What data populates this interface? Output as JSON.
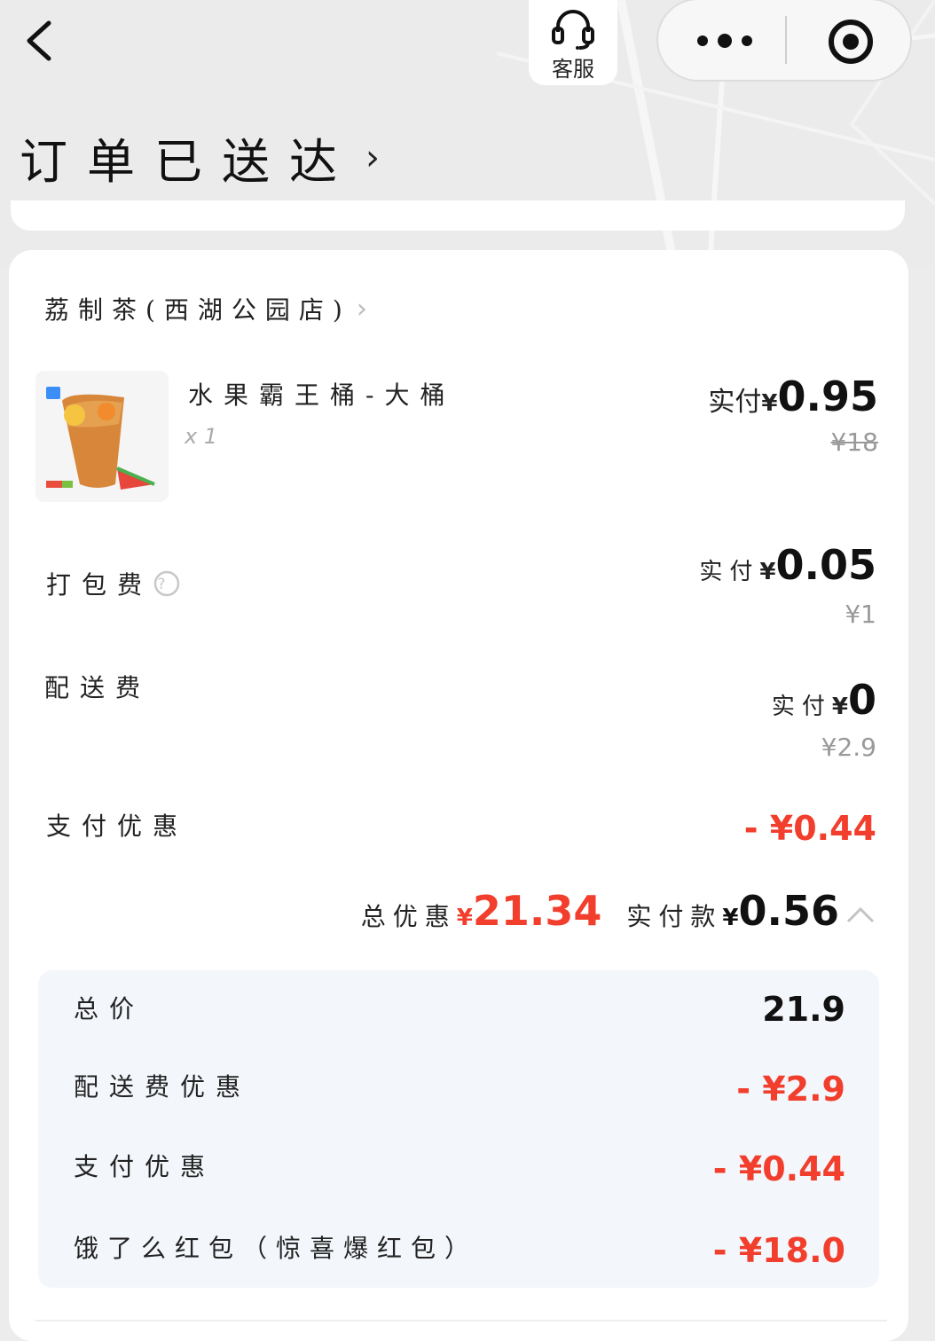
{
  "header": {
    "service_label": "客服",
    "status_title": "订单已送达"
  },
  "store": {
    "name": "荔制茶(西湖公园店)"
  },
  "product": {
    "name": "水果霸王桶-大桶",
    "qty": "x 1",
    "paid_label": "实付",
    "currency": "¥",
    "paid_amount": "0.95",
    "original_price": "¥18"
  },
  "fees": [
    {
      "label": "打包费",
      "paid_label": "实付",
      "currency": "¥",
      "paid_amount": "0.05",
      "original": "¥1"
    },
    {
      "label": "配送费",
      "paid_label": "实付",
      "currency": "¥",
      "paid_amount": "0",
      "original": "¥2.9"
    }
  ],
  "payment_discount": {
    "label": "支付优惠",
    "value": "- ¥0.44"
  },
  "summary": {
    "total_discount_label": "总优惠",
    "currency": "¥",
    "total_discount": "21.34",
    "paid_label": "实付款",
    "paid_total": "0.56"
  },
  "breakdown": [
    {
      "label": "总价",
      "value": "21.9",
      "color": "#111111"
    },
    {
      "label": "配送费优惠",
      "value": "- ¥2.9",
      "color": "#f23e2c"
    },
    {
      "label": "支付优惠",
      "value": "- ¥0.44",
      "color": "#f23e2c"
    },
    {
      "label": "饿了么红包（惊喜爆红包）",
      "value": "- ¥18.0",
      "color": "#f23e2c"
    }
  ],
  "colors": {
    "accent_red": "#f23e2c",
    "page_bg": "#ececec"
  }
}
